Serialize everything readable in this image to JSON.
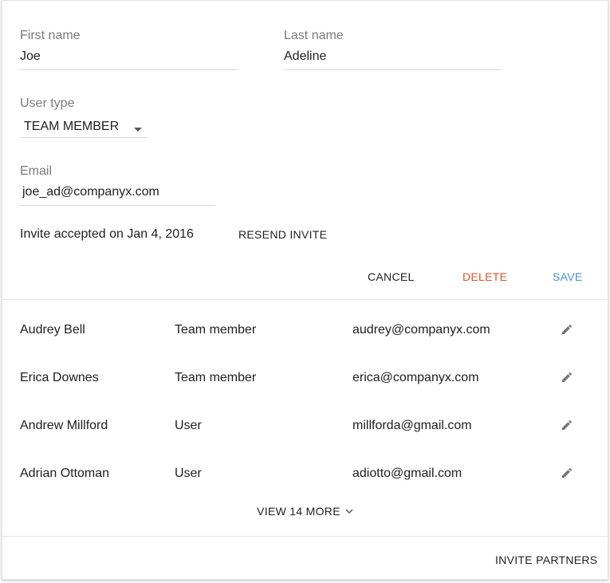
{
  "form": {
    "first_name": {
      "label": "First name",
      "value": "Joe"
    },
    "last_name": {
      "label": "Last name",
      "value": "Adeline"
    },
    "user_type": {
      "label": "User type",
      "value": "TEAM MEMBER"
    },
    "email": {
      "label": "Email",
      "value": "joe_ad@companyx.com"
    },
    "invite_status": "Invite accepted on Jan 4, 2016",
    "resend_label": "RESEND INVITE"
  },
  "actions": {
    "cancel_label": "CANCEL",
    "delete_label": "DELETE",
    "save_label": "SAVE",
    "delete_color": "#d9542b",
    "save_color": "#4a90d9"
  },
  "members": [
    {
      "name": "Audrey Bell",
      "type": "Team member",
      "email": "audrey@companyx.com"
    },
    {
      "name": "Erica Downes",
      "type": "Team member",
      "email": "erica@companyx.com"
    },
    {
      "name": "Andrew Millford",
      "type": "User",
      "email": "millforda@gmail.com"
    },
    {
      "name": "Adrian Ottoman",
      "type": "User",
      "email": "adiotto@gmail.com"
    }
  ],
  "view_more_label": "VIEW 14 MORE",
  "footer": {
    "invite_partners_label": "INVITE PARTNERS"
  },
  "icons": {
    "edit": "pencil-icon",
    "chevron": "chevron-down-icon",
    "caret": "caret-down-icon"
  }
}
